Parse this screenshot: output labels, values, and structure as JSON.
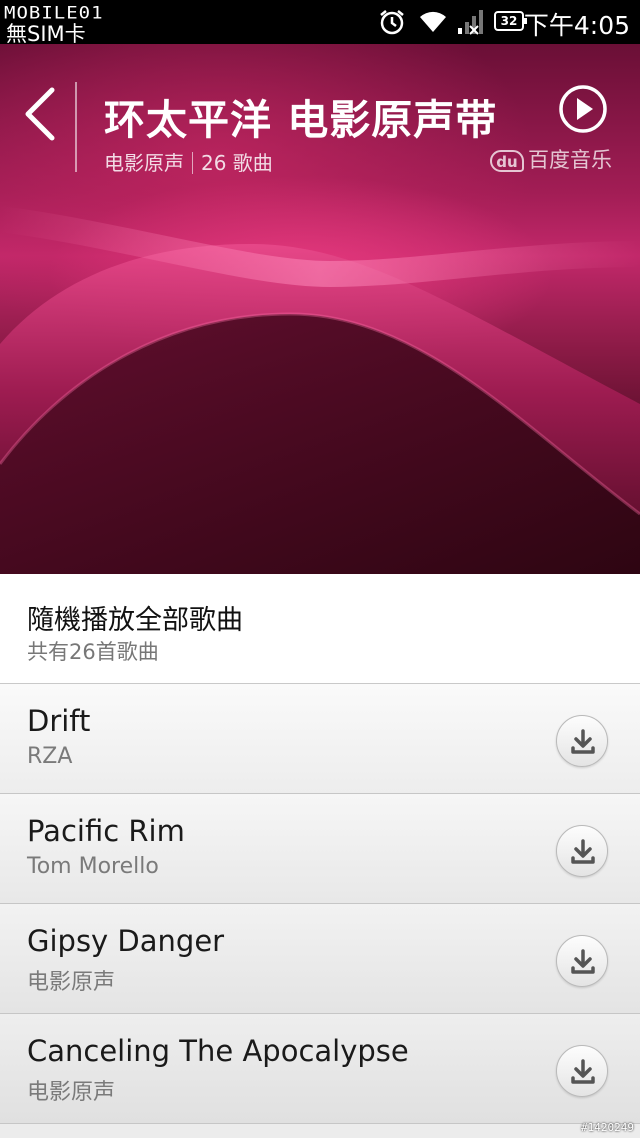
{
  "status_bar": {
    "logo": "MOBILE01",
    "carrier": "無SIM卡",
    "battery": "32",
    "time": "下午4:05",
    "icons": [
      "alarm-icon",
      "wifi-icon",
      "signal-icon",
      "battery-icon"
    ]
  },
  "album": {
    "title": "环太平洋 电影原声带",
    "category": "电影原声",
    "track_count": "26 歌曲",
    "source_badge": "du",
    "source_name": "百度音乐"
  },
  "shuffle": {
    "title": "隨機播放全部歌曲",
    "subtitle": "共有26首歌曲"
  },
  "tracks": [
    {
      "title": "Drift",
      "artist": "RZA"
    },
    {
      "title": "Pacific Rim",
      "artist": "Tom Morello"
    },
    {
      "title": "Gipsy Danger",
      "artist": "电影原声"
    },
    {
      "title": "Canceling The Apocalypse",
      "artist": "电影原声"
    }
  ],
  "watermark": "#1420249",
  "colors": {
    "hero_pink": "#c2286a",
    "hero_dark": "#3c0719",
    "list_bg": "#ececec"
  }
}
